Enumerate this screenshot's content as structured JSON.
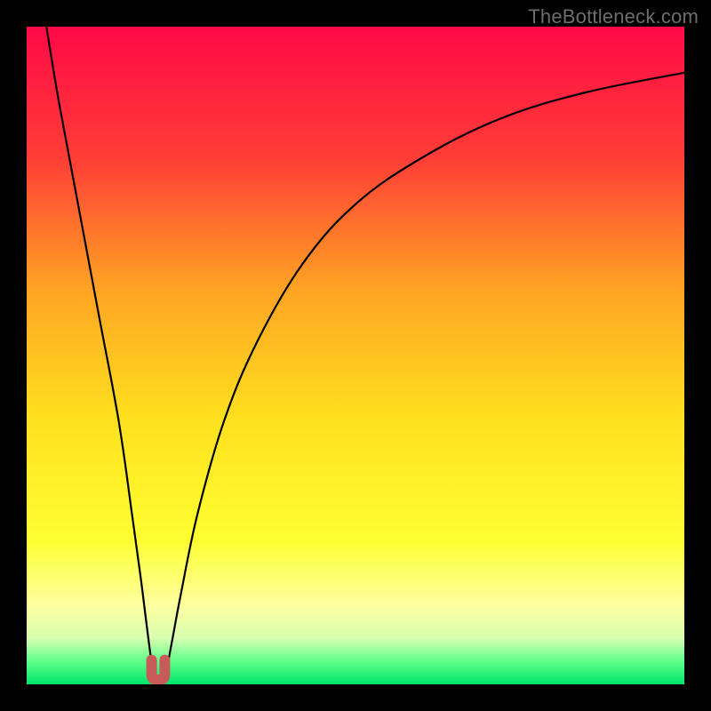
{
  "watermark": "TheBottleneck.com",
  "chart_data": {
    "type": "line",
    "title": "",
    "xlabel": "",
    "ylabel": "",
    "xlim": [
      0,
      100
    ],
    "ylim": [
      0,
      100
    ],
    "series": [
      {
        "name": "bottleneck-curve",
        "x": [
          3,
          5,
          8,
          11,
          14,
          16,
          17.5,
          18.5,
          19.2,
          19.8,
          20.5,
          21.2,
          22,
          23.5,
          26,
          30,
          35,
          42,
          50,
          60,
          72,
          85,
          100
        ],
        "y": [
          100,
          88,
          72,
          56,
          40,
          26,
          15,
          7,
          2,
          0.5,
          0.5,
          2,
          6,
          14,
          26,
          40,
          52,
          64,
          73,
          80,
          86,
          90,
          93
        ]
      }
    ],
    "marker": {
      "name": "optimal-point",
      "x_range": [
        19.0,
        21.0
      ],
      "y": 1.5,
      "color": "#c85a5a"
    },
    "gradient_stops": [
      {
        "pos": 0.0,
        "color": "#ff0a46"
      },
      {
        "pos": 0.2,
        "color": "#ff3d36"
      },
      {
        "pos": 0.4,
        "color": "#ffa423"
      },
      {
        "pos": 0.6,
        "color": "#ffe11e"
      },
      {
        "pos": 0.78,
        "color": "#ffff30"
      },
      {
        "pos": 0.88,
        "color": "#fdffa0"
      },
      {
        "pos": 0.93,
        "color": "#d8ffb0"
      },
      {
        "pos": 0.965,
        "color": "#5fff8a"
      },
      {
        "pos": 1.0,
        "color": "#00e46a"
      }
    ]
  }
}
